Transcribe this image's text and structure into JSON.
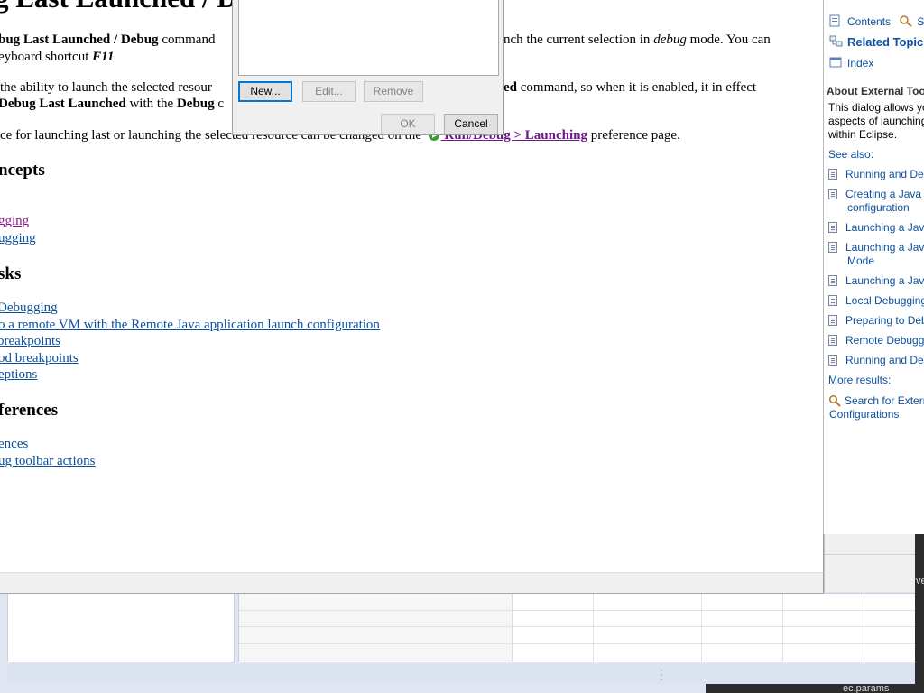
{
  "help": {
    "title": "g Last Launched / D",
    "para1_line1_bold": "bug Last Launched / Debug",
    "para1_line1_text": " command",
    "para1_line1_right_pre": "nch the current selection in ",
    "para1_line1_right_em": "debug",
    "para1_line1_right_post": " mode. You can",
    "para1_line2_pre": "eyboard shortcut ",
    "para1_line2_em": "F11",
    "para2_line1_left": " the ability to launch the selected resour",
    "para2_line1_right_bold": "ed",
    "para2_line1_right_text": " command, so when it is enabled, it in effect",
    "para2_line2_bold1": "Debug Last Launched",
    "para2_line2_text": " with the ",
    "para2_line2_bold2": "Debug",
    "para2_line2_tail": " c",
    "para3_pre": "ce for launching last or launching the selected resource can be changed on the ",
    "para3_link": " Run/Debug > Launching",
    "para3_post": " preference page.",
    "concepts_heading": "ncepts",
    "concept_links": [
      "gging",
      "ugging"
    ],
    "tasks_heading": "sks",
    "task_links": [
      " Debugging",
      "o a remote VM with the Remote Java application launch configuration",
      " breakpoints",
      "od breakpoints",
      "eptions"
    ],
    "references_heading": "ferences",
    "reference_links": [
      "ences",
      "ug toolbar actions"
    ]
  },
  "dialog": {
    "new_label": "New...",
    "edit_label": "Edit...",
    "remove_label": "Remove",
    "ok_label": "OK",
    "cancel_label": "Cancel"
  },
  "right_panel": {
    "tabs": {
      "contents": "Contents",
      "search": "Se",
      "related": "Related Topics",
      "index": "Index"
    },
    "about_title": "About External Tool",
    "about_lines": [
      "This dialog allows yo",
      "aspects of launching",
      "within Eclipse."
    ],
    "see_also": "See also:",
    "items": [
      {
        "line1": "Running and De",
        "line2": ""
      },
      {
        "line1": "Creating a Java a",
        "line2": "configuration"
      },
      {
        "line1": "Launching a Java",
        "line2": ""
      },
      {
        "line1": "Launching a Java",
        "line2": "Mode"
      },
      {
        "line1": "Launching a Java",
        "line2": ""
      },
      {
        "line1": "Local Debugging",
        "line2": ""
      },
      {
        "line1": "Preparing to Deb",
        "line2": ""
      },
      {
        "line1": "Remote Debuggi",
        "line2": ""
      },
      {
        "line1": "Running and De",
        "line2": ""
      }
    ],
    "more_results": "More results:",
    "search_result_line1": "Search for Extern",
    "search_result_line2": "Configurations"
  },
  "background": {
    "ec_params": "ec.params",
    "ve": "ve"
  }
}
